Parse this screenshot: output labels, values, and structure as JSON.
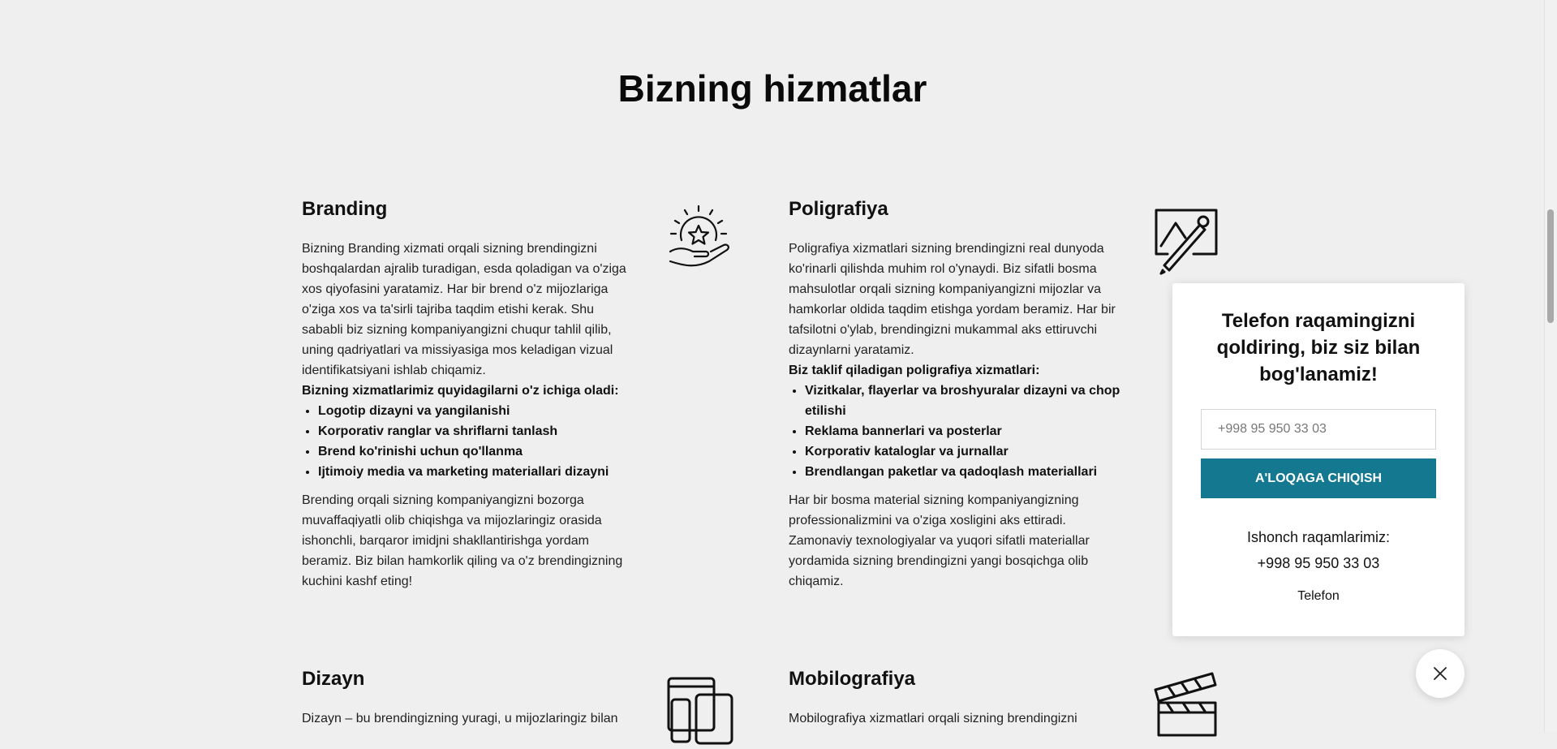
{
  "section": {
    "title": "Bizning hizmatlar"
  },
  "services": {
    "branding": {
      "title": "Branding",
      "icon": "star-hand-icon",
      "intro": "Bizning Branding xizmati orqali sizning brendingizni boshqalardan ajralib turadigan, esda qoladigan va o'ziga xos qiyofasini yaratamiz. Har bir brend o'z mijozlariga o'ziga xos va ta'sirli tajriba taqdim etishi kerak. Shu sababli biz sizning kompaniyangizni chuqur tahlil qilib, uning qadriyatlari va missiyasiga mos keladigan vizual identifikatsiyani ishlab chiqamiz.",
      "list_title": "Bizning xizmatlarimiz quyidagilarni o'z ichiga oladi:",
      "items": [
        "Logotip dizayni va yangilanishi",
        "Korporativ ranglar va shriflarni tanlash",
        "Brend ko'rinishi uchun qo'llanma",
        "Ijtimoiy media va marketing materiallari dizayni"
      ],
      "outro": "Brending orqali sizning kompaniyangizni bozorga muvaffaqiyatli olib chiqishga va mijozlaringiz orasida ishonchli, barqaror imidjni shakllantirishga yordam beramiz. Biz bilan hamkorlik qiling va o'z brendingizning kuchini kashf eting!"
    },
    "poligrafiya": {
      "title": "Poligrafiya",
      "icon": "image-pencil-icon",
      "intro": "Poligrafiya xizmatlari sizning brendingizni real dunyoda ko'rinarli qilishda muhim rol o'ynaydi. Biz sifatli bosma mahsulotlar orqali sizning kompaniyangizni mijozlar va hamkorlar oldida taqdim etishga yordam beramiz. Har bir tafsilotni o'ylab, brendingizni mukammal aks ettiruvchi dizaynlarni yaratamiz.",
      "list_title": "Biz taklif qiladigan poligrafiya xizmatlari:",
      "items": [
        "Vizitkalar, flayerlar va broshyuralar dizayni va chop etilishi",
        "Reklama bannerlari va posterlar",
        "Korporativ kataloglar va jurnallar",
        "Brendlangan paketlar va qadoqlash materiallari"
      ],
      "outro": "Har bir bosma material sizning kompaniyangizning professionalizmini va o'ziga xosligini aks ettiradi. Zamonaviy texnologiyalar va yuqori sifatli materiallar yordamida sizning brendingizni yangi bosqichga olib chiqamiz."
    },
    "dizayn": {
      "title": "Dizayn",
      "icon": "devices-icon",
      "intro": "Dizayn – bu brendingizning yuragi, u mijozlaringiz bilan"
    },
    "mobilografiya": {
      "title": "Mobilografiya",
      "icon": "clapperboard-icon",
      "intro": "Mobilografiya xizmatlari orqali sizning brendingizni"
    }
  },
  "popup": {
    "title": "Telefon raqamingizni qoldiring, biz siz bilan bog'lanamiz!",
    "phone_placeholder": "+998 95 950 33 03",
    "submit_label": "A'LOQAGA CHIQISH",
    "trust_label": "Ishonch raqamlarimiz:",
    "trust_number": "+998 95 950 33 03",
    "phone_link": "Telefon",
    "accent_color": "#137890"
  },
  "close_button": {
    "icon": "close-icon"
  }
}
